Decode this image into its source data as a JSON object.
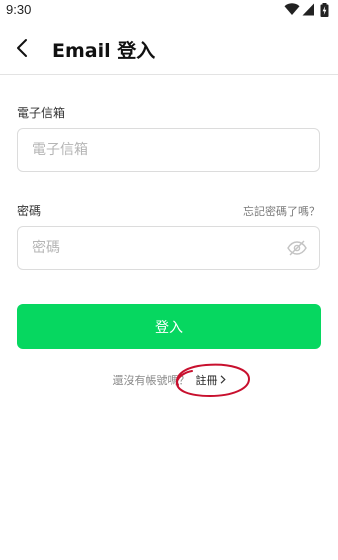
{
  "status_bar": {
    "time": "9:30",
    "icons": [
      "wifi-icon",
      "signal-icon",
      "battery-icon"
    ]
  },
  "header": {
    "back_icon": "back-arrow-icon",
    "title": "Email 登入"
  },
  "form": {
    "email": {
      "label": "電子信箱",
      "value": "",
      "placeholder": "電子信箱"
    },
    "password": {
      "label": "密碼",
      "value": "",
      "placeholder": "密碼",
      "forgot_label": "忘記密碼了嗎？",
      "visibility_icon": "eye-off-icon"
    },
    "login_label": "登入"
  },
  "signup": {
    "prompt": "還沒有帳號嗎？",
    "link_label": "註冊",
    "chevron_icon": "chevron-right-icon"
  },
  "colors": {
    "accent": "#06d760",
    "annotation": "#c8102e"
  }
}
